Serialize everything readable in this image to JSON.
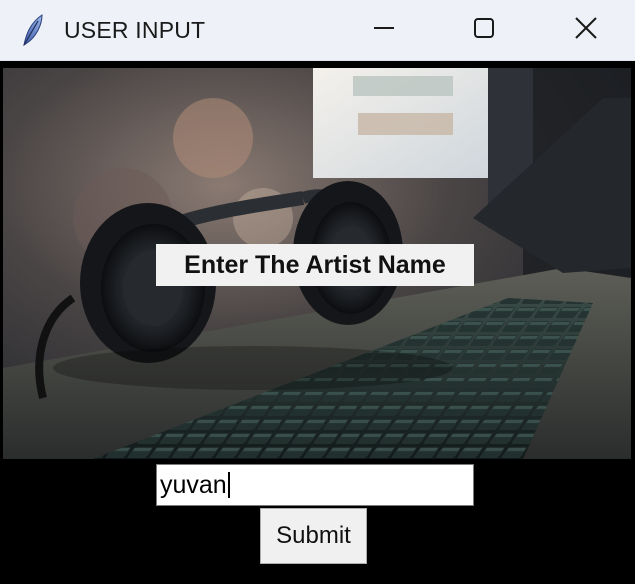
{
  "window": {
    "title": "USER INPUT",
    "icon": "feather-icon",
    "controls": {
      "minimize": "minimize-icon",
      "maximize": "maximize-icon",
      "close": "close-icon"
    }
  },
  "banner": {
    "image": "headphones-on-laptop-keyboard",
    "label": "Enter The Artist Name"
  },
  "form": {
    "artist_value": "yuvan",
    "submit_label": "Submit"
  },
  "colors": {
    "titlebar": "#eef2f8",
    "background": "#000000",
    "label_bg": "#f1f1f1",
    "button_bg": "#f0f0f0"
  }
}
